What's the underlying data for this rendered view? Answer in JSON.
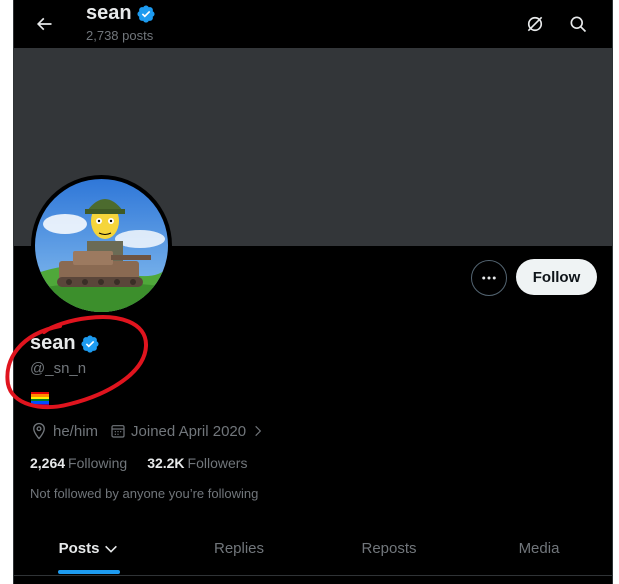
{
  "header": {
    "title": "sean",
    "post_count": "2,738 posts",
    "icons": [
      "back-arrow-icon",
      "grok-icon",
      "search-icon"
    ]
  },
  "profile": {
    "display_name": "sean",
    "handle": "@_sn_n",
    "verified": true,
    "pronouns": "he/him",
    "joined": "Joined April 2020",
    "following_count": "2,264",
    "following_label": "Following",
    "followers_count": "32.2K",
    "followers_label": "Followers",
    "not_followed_text": "Not followed by anyone you’re following",
    "bio_emoji": "rainbow-flag"
  },
  "actions": {
    "more_icon": "more-icon",
    "follow_label": "Follow"
  },
  "tabs": [
    {
      "label": "Posts",
      "active": true
    },
    {
      "label": "Replies",
      "active": false
    },
    {
      "label": "Reposts",
      "active": false
    },
    {
      "label": "Media",
      "active": false
    }
  ],
  "colors": {
    "accent": "#1d9bf0",
    "verified": "#1d9bf0",
    "annotation": "#e0141e",
    "background": "#000000",
    "banner": "#333639"
  }
}
